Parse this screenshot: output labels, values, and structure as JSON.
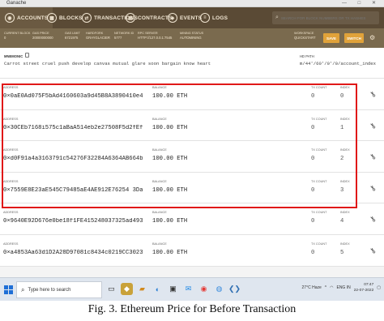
{
  "window": {
    "title": "Ganache",
    "controls": "— □ ✕"
  },
  "nav": {
    "items": [
      {
        "label": "ACCOUNTS",
        "icon": "accounts-icon",
        "glyph": "◉",
        "active": true
      },
      {
        "label": "BLOCKS",
        "icon": "blocks-icon",
        "glyph": "▦",
        "active": false
      },
      {
        "label": "TRANSACTIONS",
        "icon": "transactions-icon",
        "glyph": "⇄",
        "active": false
      },
      {
        "label": "CONTRACTS",
        "icon": "contracts-icon",
        "glyph": "▤",
        "active": false
      },
      {
        "label": "EVENTS",
        "icon": "events-icon",
        "glyph": "◈",
        "active": false
      },
      {
        "label": "LOGS",
        "icon": "logs-icon",
        "glyph": "≡",
        "active": false
      }
    ],
    "search_placeholder": "SEARCH FOR BLOCK NUMBERS OR TX HASHES"
  },
  "status": {
    "current_block": {
      "label": "CURRENT BLOCK",
      "value": "0"
    },
    "gas_price": {
      "label": "GAS PRICE",
      "value": "20000000000"
    },
    "gas_limit": {
      "label": "GAS LIMIT",
      "value": "6721975"
    },
    "hardfork": {
      "label": "HARDFORK",
      "value": "GRAYGLACIER"
    },
    "network_id": {
      "label": "NETWORK ID",
      "value": "5777"
    },
    "rpc_server": {
      "label": "RPC SERVER",
      "value": "HTTP://127.0.0.1:7545"
    },
    "mining_status": {
      "label": "MINING STATUS",
      "value": "AUTOMINING"
    },
    "workspace": {
      "label": "WORKSPACE",
      "value": "QUICKSTART"
    },
    "save_label": "SAVE",
    "switch_label": "SWITCH"
  },
  "mnemonic": {
    "label": "MNEMONIC",
    "words": "Carrot street cruel push develop canvas mutual glare soon bargain know heart",
    "hd_path_label": "HD PATH",
    "hd_path": "m/44'/60'/0'/0/account_index"
  },
  "column_labels": {
    "address": "ADDRESS",
    "balance": "BALANCE",
    "tx_count": "TX COUNT",
    "index": "INDEX"
  },
  "accounts": [
    {
      "address": "0×0aE0Ad075F5bAd4160603a9d45B8A3890410e4C0",
      "balance": "100.00 ETH",
      "tx_count": "0",
      "index": "0"
    },
    {
      "address": "0×30CEb7168i575c1aBaA514eb2e27508F5d2fEf1",
      "balance": "100.00 ETH",
      "tx_count": "0",
      "index": "1"
    },
    {
      "address": "0×d0F91a4a3163791c54276F32284A6364AB664bF3",
      "balance": "100.00 ETH",
      "tx_count": "0",
      "index": "2"
    },
    {
      "address": "0×7559E8E23aE545C79485aE4AE912E76254 3Da6e5",
      "balance": "100.00 ETH",
      "tx_count": "0",
      "index": "3"
    },
    {
      "address": "0×9640E92D676e0be18f1FE415248037325ad493",
      "balance": "100.00 ETH",
      "tx_count": "0",
      "index": "4"
    },
    {
      "address": "0×a4853Aa63d1D2A28D97081c8434c0219CC3023",
      "balance": "100.00 ETH",
      "tx_count": "0",
      "index": "5"
    }
  ],
  "taskbar": {
    "search_placeholder": "Type here to search",
    "weather": "27°C Haze",
    "lang": "ENG IN",
    "time": "07:47",
    "date": "22-07-2022"
  },
  "caption": "Fig. 3. Ethereum Price for Before Transaction",
  "colors": {
    "nav": "#5a4a35",
    "status": "#7a6a4e",
    "accent": "#e0a23a",
    "highlight": "#e01818"
  }
}
